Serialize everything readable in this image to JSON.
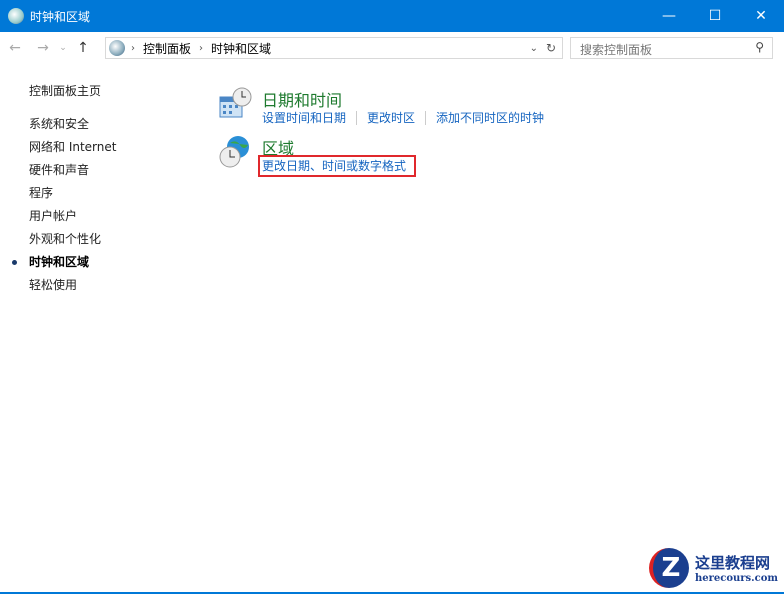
{
  "window": {
    "title": "时钟和区域"
  },
  "address": {
    "crumbs": [
      "控制面板",
      "时钟和区域"
    ],
    "search_placeholder": "搜索控制面板"
  },
  "sidebar": {
    "home": "控制面板主页",
    "items": [
      "系统和安全",
      "网络和 Internet",
      "硬件和声音",
      "程序",
      "用户帐户",
      "外观和个性化",
      "时钟和区域",
      "轻松使用"
    ],
    "active": "时钟和区域"
  },
  "categories": [
    {
      "title": "日期和时间",
      "links": [
        "设置时间和日期",
        "更改时区",
        "添加不同时区的时钟"
      ]
    },
    {
      "title": "区域",
      "links": [
        "更改日期、时间或数字格式"
      ]
    }
  ],
  "watermark": {
    "name": "这里教程网",
    "url": "herecours.com"
  },
  "colors": {
    "titlebar": "#0078d7",
    "link": "#1665c0",
    "heading": "#1e7a2e",
    "highlight": "#e0282c"
  }
}
